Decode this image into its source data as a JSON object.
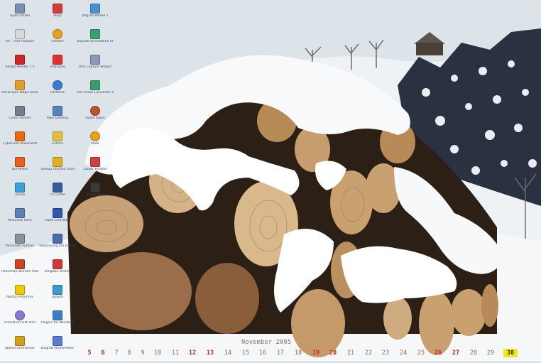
{
  "desktop": {
    "icons": [
      {
        "label": "Sysfo Install",
        "icon": "system-info-icon",
        "color": "#7d8fb3"
      },
      {
        "label": "XX - Free Pictures",
        "icon": "document-icon",
        "color": "#d9d9d9"
      },
      {
        "label": "Adobe Reader 7.0",
        "icon": "adobe-reader-icon",
        "color": "#c62828"
      },
      {
        "label": "Ashampoo Magic Burning",
        "icon": "burner-icon",
        "color": "#e0a030"
      },
      {
        "label": "Cover Reader",
        "icon": "scanner-icon",
        "color": "#708090"
      },
      {
        "label": "CyberLink PowerDVD",
        "icon": "dvd-player-icon",
        "color": "#e86a10"
      },
      {
        "label": "BurnePlot",
        "icon": "burn-icon",
        "color": "#e8601c"
      },
      {
        "label": "iTunes",
        "icon": "itunes-icon",
        "color": "#3aa0d8"
      },
      {
        "label": "Microsoft Paint",
        "icon": "paint-icon",
        "color": "#5a7fb0"
      },
      {
        "label": "Microsoft Outlook",
        "icon": "outlook-icon",
        "color": "#8a8f98"
      },
      {
        "label": "Paintshop Wunder Powertool",
        "icon": "paint-tool-icon",
        "color": "#cc4422"
      },
      {
        "label": "Norton AntiVirus",
        "icon": "norton-icon",
        "color": "#f0c800"
      },
      {
        "label": "SmartConnect PRO",
        "icon": "network-globe-icon",
        "color": "#8877cc"
      },
      {
        "label": "SpaceCommander",
        "icon": "commander-icon",
        "color": "#d2a020"
      },
      {
        "label": "eBay",
        "icon": "ebay-icon",
        "color": "#d23c3c"
      },
      {
        "label": "Seedee",
        "icon": "music-disc-icon",
        "color": "#e8a020"
      },
      {
        "label": "IrfanView",
        "icon": "irfanview-icon",
        "color": "#e03030"
      },
      {
        "label": "Pitchfork",
        "icon": "player-icon",
        "color": "#3a7ad0"
      },
      {
        "label": "Fake Desktop",
        "icon": "desktop-icon",
        "color": "#5a80c0"
      },
      {
        "label": "Entries",
        "icon": "note-icon",
        "color": "#e0c040"
      },
      {
        "label": "Tuneup Utilities 2004",
        "icon": "tuneup-icon",
        "color": "#e0b020"
      },
      {
        "label": "TV Center",
        "icon": "tv-icon",
        "color": "#3a5aa0"
      },
      {
        "label": "ISDN Controller",
        "icon": "isdn-icon",
        "color": "#3355aa"
      },
      {
        "label": "Verbindung mit Internet",
        "icon": "connection-icon",
        "color": "#4a6aaa"
      },
      {
        "label": "Freigabe Ordner",
        "icon": "shared-folder-icon",
        "color": "#d03a3a"
      },
      {
        "label": "Splash",
        "icon": "splash-icon",
        "color": "#3a9ad0"
      },
      {
        "label": "Plugins für Windows",
        "icon": "plugin-icon",
        "color": "#3a80c0"
      },
      {
        "label": "DVgrab PhonePower",
        "icon": "phone-icon",
        "color": "#5a7ad0"
      },
      {
        "label": "DVgrab Winter 1",
        "icon": "video-icon",
        "color": "#4a90d0"
      },
      {
        "label": "DVgrab Schneeland Impressionen",
        "icon": "video-clip-icon",
        "color": "#3aa070"
      },
      {
        "label": "AVS Capture Wizard",
        "icon": "capture-icon",
        "color": "#8a9ab0"
      },
      {
        "label": "AVS Video Converter 4",
        "icon": "converter-icon",
        "color": "#3a9a70"
      },
      {
        "label": "Dowe Stash",
        "icon": "user-icon",
        "color": "#c05030"
      },
      {
        "label": "Mate",
        "icon": "flower-icon",
        "color": "#e8a020"
      },
      {
        "label": "Lauter Fenster",
        "icon": "window-icon",
        "color": "#d04040"
      },
      {
        "label": "Freiheiten",
        "icon": "folder-icon",
        "color": "#3a3a3a"
      }
    ]
  },
  "calendar": {
    "month": "November 2005",
    "days": [
      {
        "d": "5",
        "type": "sat"
      },
      {
        "d": "6",
        "type": "sun"
      },
      {
        "d": "7",
        "type": "week"
      },
      {
        "d": "8",
        "type": "week"
      },
      {
        "d": "9",
        "type": "week"
      },
      {
        "d": "10",
        "type": "week"
      },
      {
        "d": "11",
        "type": "week"
      },
      {
        "d": "12",
        "type": "sat"
      },
      {
        "d": "13",
        "type": "sun"
      },
      {
        "d": "14",
        "type": "week"
      },
      {
        "d": "15",
        "type": "week"
      },
      {
        "d": "16",
        "type": "week"
      },
      {
        "d": "17",
        "type": "week"
      },
      {
        "d": "18",
        "type": "week"
      },
      {
        "d": "19",
        "type": "sat"
      },
      {
        "d": "20",
        "type": "sun"
      },
      {
        "d": "21",
        "type": "week"
      },
      {
        "d": "22",
        "type": "week"
      },
      {
        "d": "23",
        "type": "week"
      },
      {
        "d": "24",
        "type": "week"
      },
      {
        "d": "25",
        "type": "week"
      },
      {
        "d": "26",
        "type": "sat"
      },
      {
        "d": "27",
        "type": "sun"
      },
      {
        "d": "28",
        "type": "week"
      },
      {
        "d": "29",
        "type": "week"
      },
      {
        "d": "30",
        "type": "today"
      }
    ]
  }
}
